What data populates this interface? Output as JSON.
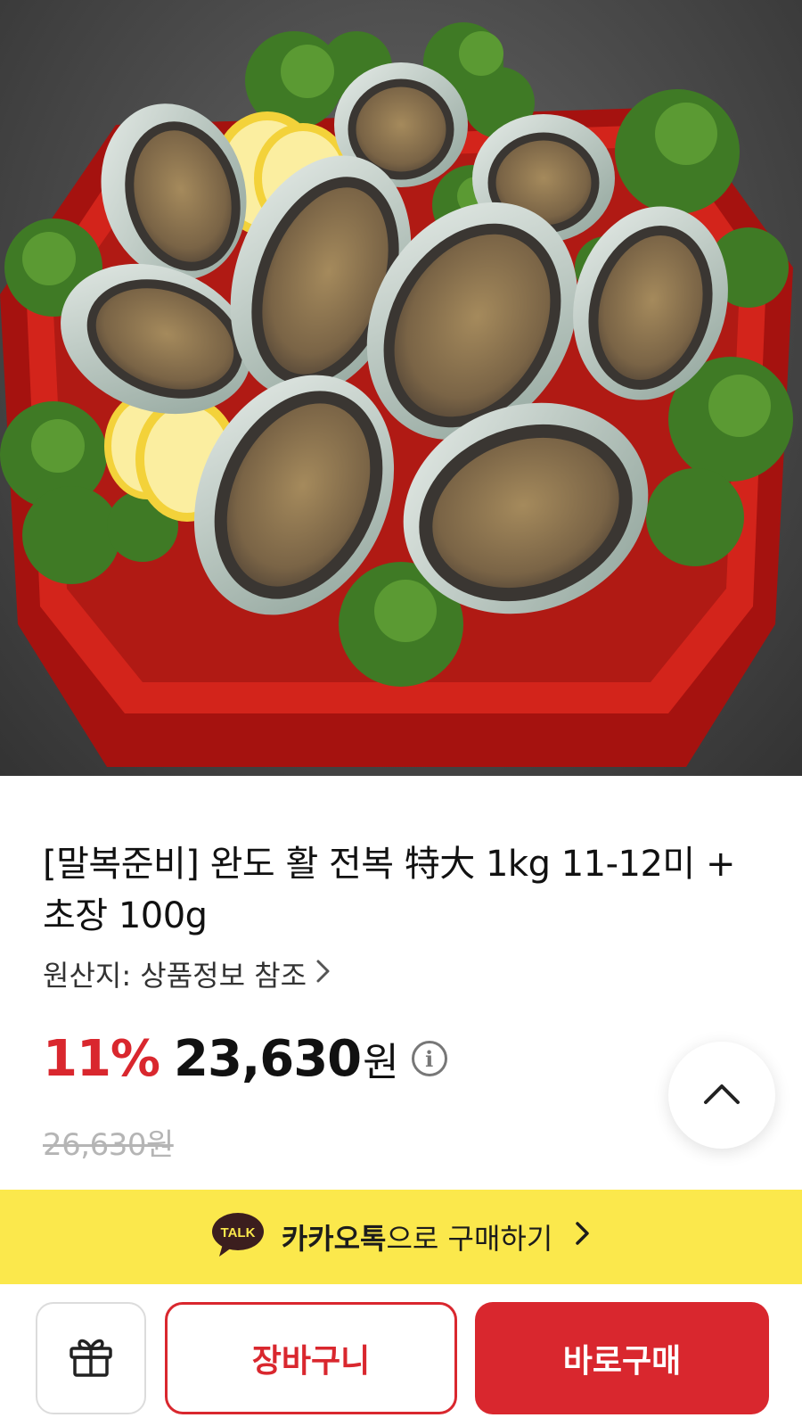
{
  "product": {
    "image_alt": "abalone-platter-photo",
    "title": "[말복준비] 완도 활 전복 特大 1kg 11-12미 + 초장 100g",
    "origin_label": "원산지: 상품정보 참조",
    "discount": "11%",
    "price": "23,630",
    "currency": "원",
    "original_price": "26,630원"
  },
  "kakao": {
    "badge": "TALK",
    "brand": "카카오톡",
    "suffix": "으로 구매하기"
  },
  "actions": {
    "cart_label": "장바구니",
    "buy_label": "바로구매"
  },
  "colors": {
    "accent": "#d9272e",
    "kakao_yellow": "#fbe84c",
    "muted": "#b5b5b5"
  },
  "icons": {
    "info": "info-circle-icon",
    "origin_chevron": "chevron-right-icon",
    "scroll_top": "chevron-up-icon",
    "kakao": "kakao-talk-icon",
    "gift": "gift-icon"
  }
}
